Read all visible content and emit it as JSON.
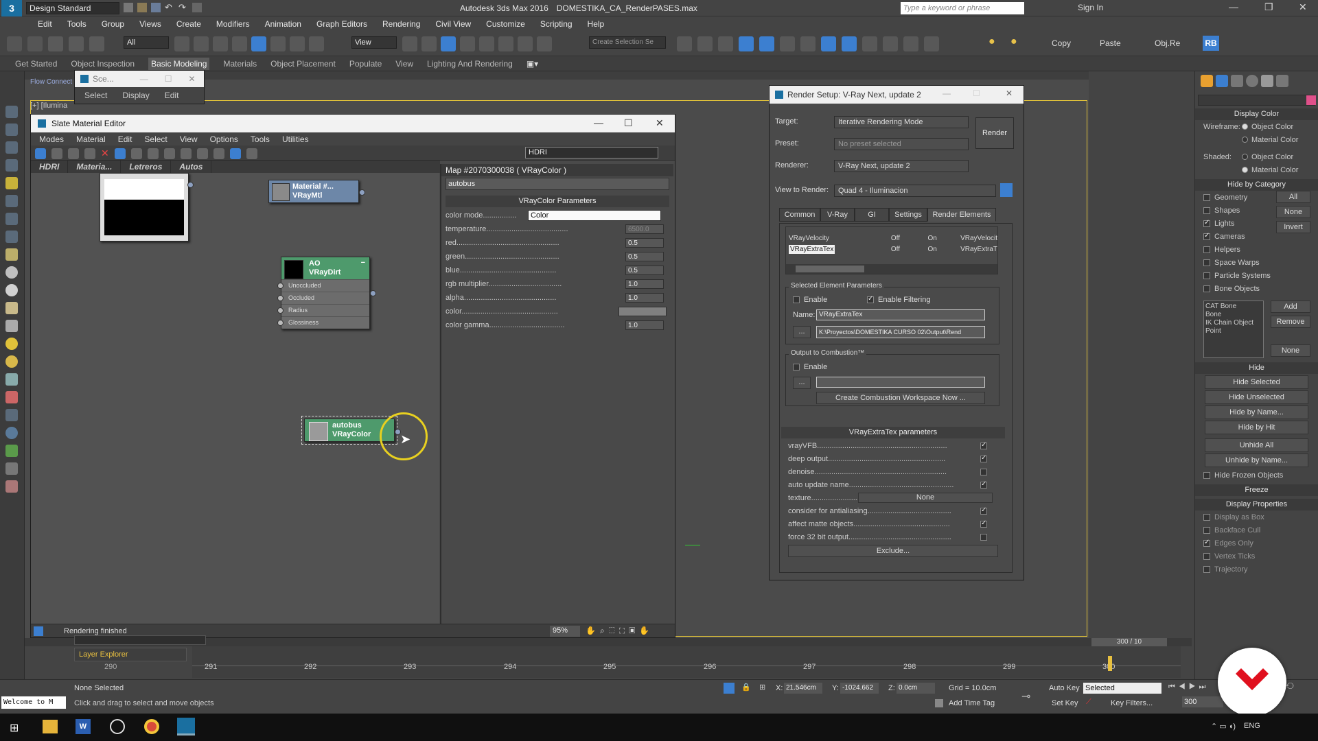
{
  "app": {
    "workspace": "Design Standard",
    "title": "Autodesk 3ds Max 2016",
    "file": "DOMESTIKA_CA_RenderPASES.max",
    "search_placeholder": "Type a keyword or phrase",
    "sign_in": "Sign In"
  },
  "menubar": [
    "Edit",
    "Tools",
    "Group",
    "Views",
    "Create",
    "Modifiers",
    "Animation",
    "Graph Editors",
    "Rendering",
    "Civil View",
    "Customize",
    "Scripting",
    "Help"
  ],
  "toolbar": {
    "filter": "All",
    "view": "View",
    "selection_set": "Create Selection Se",
    "copy": "Copy",
    "paste": "Paste",
    "objre": "Obj.Re",
    "rb": "RB"
  },
  "ribbon": [
    "Get Started",
    "Object Inspection",
    "Basic Modeling",
    "Materials",
    "Object Placement",
    "Populate",
    "View",
    "Lighting And Rendering"
  ],
  "viewport_label": "[+] [Ilumina",
  "flow_connect": "Flow Connect",
  "scene_dialog": {
    "title": "Sce...",
    "menu": [
      "Select",
      "Display",
      "Edit"
    ]
  },
  "slate": {
    "title": "Slate Material Editor",
    "menu": [
      "Modes",
      "Material",
      "Edit",
      "Select",
      "View",
      "Options",
      "Tools",
      "Utilities"
    ],
    "view_combo": "HDRI",
    "tabs": [
      "HDRI",
      "Materia...",
      "Letreros",
      "Autos"
    ],
    "nodes": {
      "material": {
        "line1": "Material #...",
        "line2": "VRayMtl"
      },
      "ao": {
        "line1": "AO",
        "line2": "VRayDirt",
        "slots": [
          "Unoccluded",
          "Occluded",
          "Radius",
          "Glossiness"
        ]
      },
      "autobus": {
        "line1": "autobus",
        "line2": "VRayColor"
      }
    },
    "param": {
      "header": "Map #2070300038  ( VRayColor )",
      "name": "autobus",
      "rollout": "VRayColor Parameters",
      "rows": [
        {
          "label": "color mode................",
          "value": "Color"
        },
        {
          "label": "temperature.......................................",
          "value": "6500.0"
        },
        {
          "label": "red.................................................",
          "value": "0.5"
        },
        {
          "label": "green.............................................",
          "value": "0.5"
        },
        {
          "label": "blue..............................................",
          "value": "0.5"
        },
        {
          "label": "rgb multiplier...................................",
          "value": "1.0"
        },
        {
          "label": "alpha............................................",
          "value": "1.0"
        },
        {
          "label": "color..............................................",
          "value": ""
        },
        {
          "label": "color gamma....................................",
          "value": "1.0"
        }
      ]
    },
    "status": "Rendering finished",
    "zoom": "95%"
  },
  "render_setup": {
    "title": "Render Setup: V-Ray Next, update 2",
    "target_label": "Target:",
    "target": "Iterative Rendering Mode",
    "preset_label": "Preset:",
    "preset": "No preset selected",
    "renderer_label": "Renderer:",
    "renderer": "V-Ray Next, update 2",
    "view_label": "View to Render:",
    "view": "Quad 4 - Iluminacion",
    "render_btn": "Render",
    "tabs": [
      "Common",
      "V-Ray",
      "GI",
      "Settings",
      "Render Elements"
    ],
    "elements": [
      {
        "name": "VRayVelocity",
        "a": "Off",
        "b": "On",
        "c": "VRayVelocit"
      },
      {
        "name": "VRayExtraTex",
        "a": "Off",
        "b": "On",
        "c": "VRayExtraT"
      }
    ],
    "sel_group": "Selected Element Parameters",
    "enable": "Enable",
    "enable_filtering": "Enable Filtering",
    "name_label": "Name:",
    "name_value": "VRayExtraTex",
    "path_value": "K:\\Proyectos\\DOMESTIKA CURSO 02\\Output\\Rend",
    "browse": "...",
    "combustion_group": "Output to Combustion™",
    "combustion_enable": "Enable",
    "combustion_btn": "Create Combustion Workspace Now ...",
    "extratex_rollout": "VRayExtraTex parameters",
    "extratex_rows": [
      {
        "label": "vrayVFB..............................................................",
        "checked": true
      },
      {
        "label": "deep output........................................................",
        "checked": true
      },
      {
        "label": "denoise...............................................................",
        "checked": false
      },
      {
        "label": "auto update name..................................................",
        "checked": true
      },
      {
        "label": "texture...........................",
        "checked": null,
        "value": "None"
      },
      {
        "label": "consider for antialiasing........................................",
        "checked": true
      },
      {
        "label": "affect matte objects..............................................",
        "checked": true
      },
      {
        "label": "force 32 bit output.................................................",
        "checked": false
      }
    ],
    "exclude": "Exclude..."
  },
  "command_panel": {
    "display_color": "Display Color",
    "wireframe": "Wireframe:",
    "shaded": "Shaded:",
    "object_color": "Object Color",
    "material_color": "Material Color",
    "hide_by_category": "Hide by Category",
    "categories": [
      {
        "label": "Geometry",
        "checked": false
      },
      {
        "label": "Shapes",
        "checked": false
      },
      {
        "label": "Lights",
        "checked": true
      },
      {
        "label": "Cameras",
        "checked": true
      },
      {
        "label": "Helpers",
        "checked": false
      },
      {
        "label": "Space Warps",
        "checked": false
      },
      {
        "label": "Particle Systems",
        "checked": false
      },
      {
        "label": "Bone Objects",
        "checked": false
      }
    ],
    "cat_buttons": [
      "All",
      "None",
      "Invert"
    ],
    "list_items": [
      "CAT Bone",
      "Bone",
      "IK Chain Object",
      "Point"
    ],
    "list_buttons": [
      "Add",
      "Remove",
      "None"
    ],
    "hide": "Hide",
    "hide_buttons": [
      "Hide Selected",
      "Hide Unselected",
      "Hide by Name...",
      "Hide by Hit",
      "Unhide All",
      "Unhide by Name..."
    ],
    "hide_frozen": "Hide Frozen Objects",
    "freeze": "Freeze",
    "display_properties": "Display Properties",
    "display_rows": [
      {
        "label": "Display as Box",
        "checked": false
      },
      {
        "label": "Backface Cull",
        "checked": false
      },
      {
        "label": "Edges Only",
        "checked": true
      },
      {
        "label": "Vertex Ticks",
        "checked": false
      },
      {
        "label": "Trajectory",
        "checked": false
      }
    ]
  },
  "timeline": {
    "ticks": [
      "290",
      "291",
      "292",
      "293",
      "294",
      "295",
      "296",
      "297",
      "298",
      "299",
      "300"
    ],
    "frame": "300 / 10",
    "layer_explorer": "Layer Explorer"
  },
  "status": {
    "welcome": "Welcome to M",
    "selection": "None Selected",
    "hint": "Click and drag to select and move objects",
    "x_label": "X:",
    "x": "21.546cm",
    "y_label": "Y:",
    "y": "-1024.662",
    "z_label": "Z:",
    "z": "0.0cm",
    "grid": "Grid = 10.0cm",
    "add_time_tag": "Add Time Tag",
    "auto_key": "Auto Key",
    "set_key": "Set Key",
    "selected": "Selected",
    "key_filters": "Key Filters...",
    "frame": "300"
  },
  "taskbar": {
    "lang": "ENG"
  },
  "colors": {
    "accent": "#3c7fd0",
    "node_green": "#4d9a6a",
    "logo_red": "#e0101e"
  }
}
